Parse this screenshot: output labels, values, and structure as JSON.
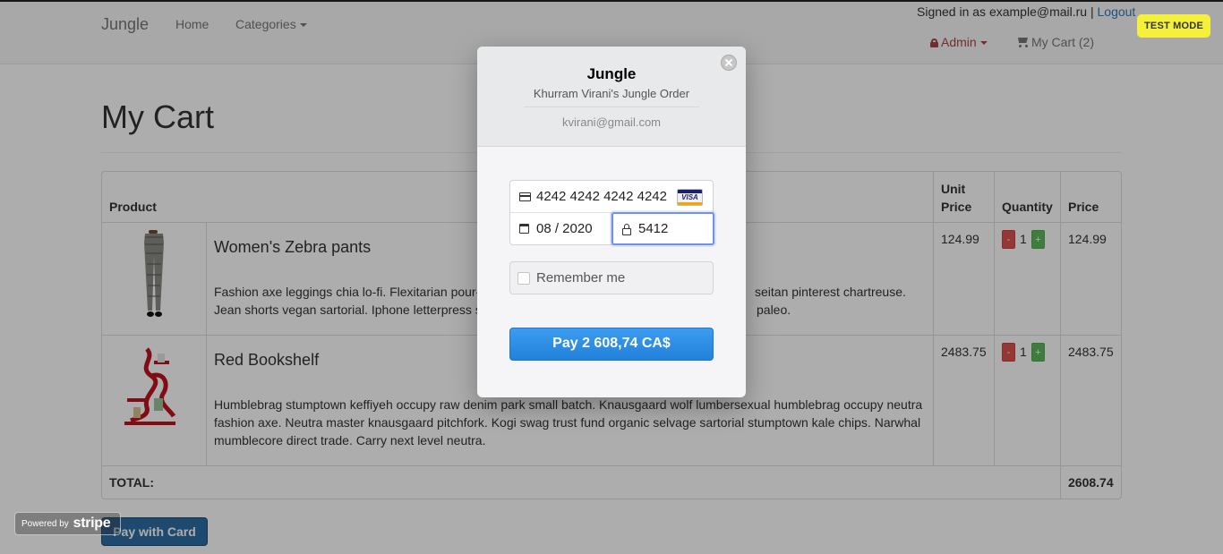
{
  "navbar": {
    "brand": "Jungle",
    "home": "Home",
    "categories": "Categories",
    "signed_in_text": "Signed in as example@mail.ru |",
    "logout": "Logout",
    "admin": "Admin",
    "my_cart": "My Cart (2)",
    "test_mode": "TEST MODE"
  },
  "page": {
    "title": "My Cart"
  },
  "table": {
    "headers": {
      "product": "Product",
      "unit_price": "Unit Price",
      "quantity": "Quantity",
      "price": "Price"
    },
    "rows": [
      {
        "name": "Women's Zebra pants",
        "description": "Fashion axe leggings chia lo-fi. Flexitarian pour-over cold-pressed, actually seitan pinterest chartreuse. Jean shorts vegan sartorial. Iphone letterpress scenester, blue bottle 3 wolf moon paleo.",
        "desc_line1_left": "Fashion axe leggings chia lo-fi. Flexitarian pour-",
        "desc_line1_right": "seitan pinterest chartreuse.",
        "desc_line2_left": "Jean shorts vegan sartorial. Iphone letterpress s",
        "desc_line2_right": "paleo.",
        "unit_price": "124.99",
        "quantity": "1",
        "price": "124.99",
        "minus": "-",
        "plus": "+"
      },
      {
        "name": "Red Bookshelf",
        "description_lines": [
          "Humblebrag stumptown keffiyeh occupy raw denim park small batch. Knausgaard wolf lumbersexual humblebrag occupy neutra",
          "fashion axe. Neutra master knausgaard pitchfork. Kogi swag trust fund organic selvage sartorial stumptown kale chips. Narwhal",
          "mumblecore direct trade. Carry next level neutra."
        ],
        "unit_price": "2483.75",
        "quantity": "1",
        "price": "2483.75",
        "minus": "-",
        "plus": "+"
      }
    ],
    "total_label": "TOTAL:",
    "total_value": "2608.74"
  },
  "pay_with_card": "Pay with Card",
  "powered_by": {
    "prefix": "Powered by",
    "brand": "stripe"
  },
  "checkout": {
    "title": "Jungle",
    "subtitle": "Khurram Virani's Jungle Order",
    "email": "kvirani@gmail.com",
    "card_number": "4242 4242 4242 4242",
    "card_brand": "VISA",
    "expiry": "08 / 2020",
    "cvc": "5412",
    "remember_me": "Remember me",
    "pay_button": "Pay 2 608,74 CA$"
  },
  "colors": {
    "pay_button": "#2281d9",
    "test_mode": "#f5f03b",
    "admin": "#a94442",
    "qty_minus": "#d9534f",
    "qty_plus": "#5cb85c"
  }
}
